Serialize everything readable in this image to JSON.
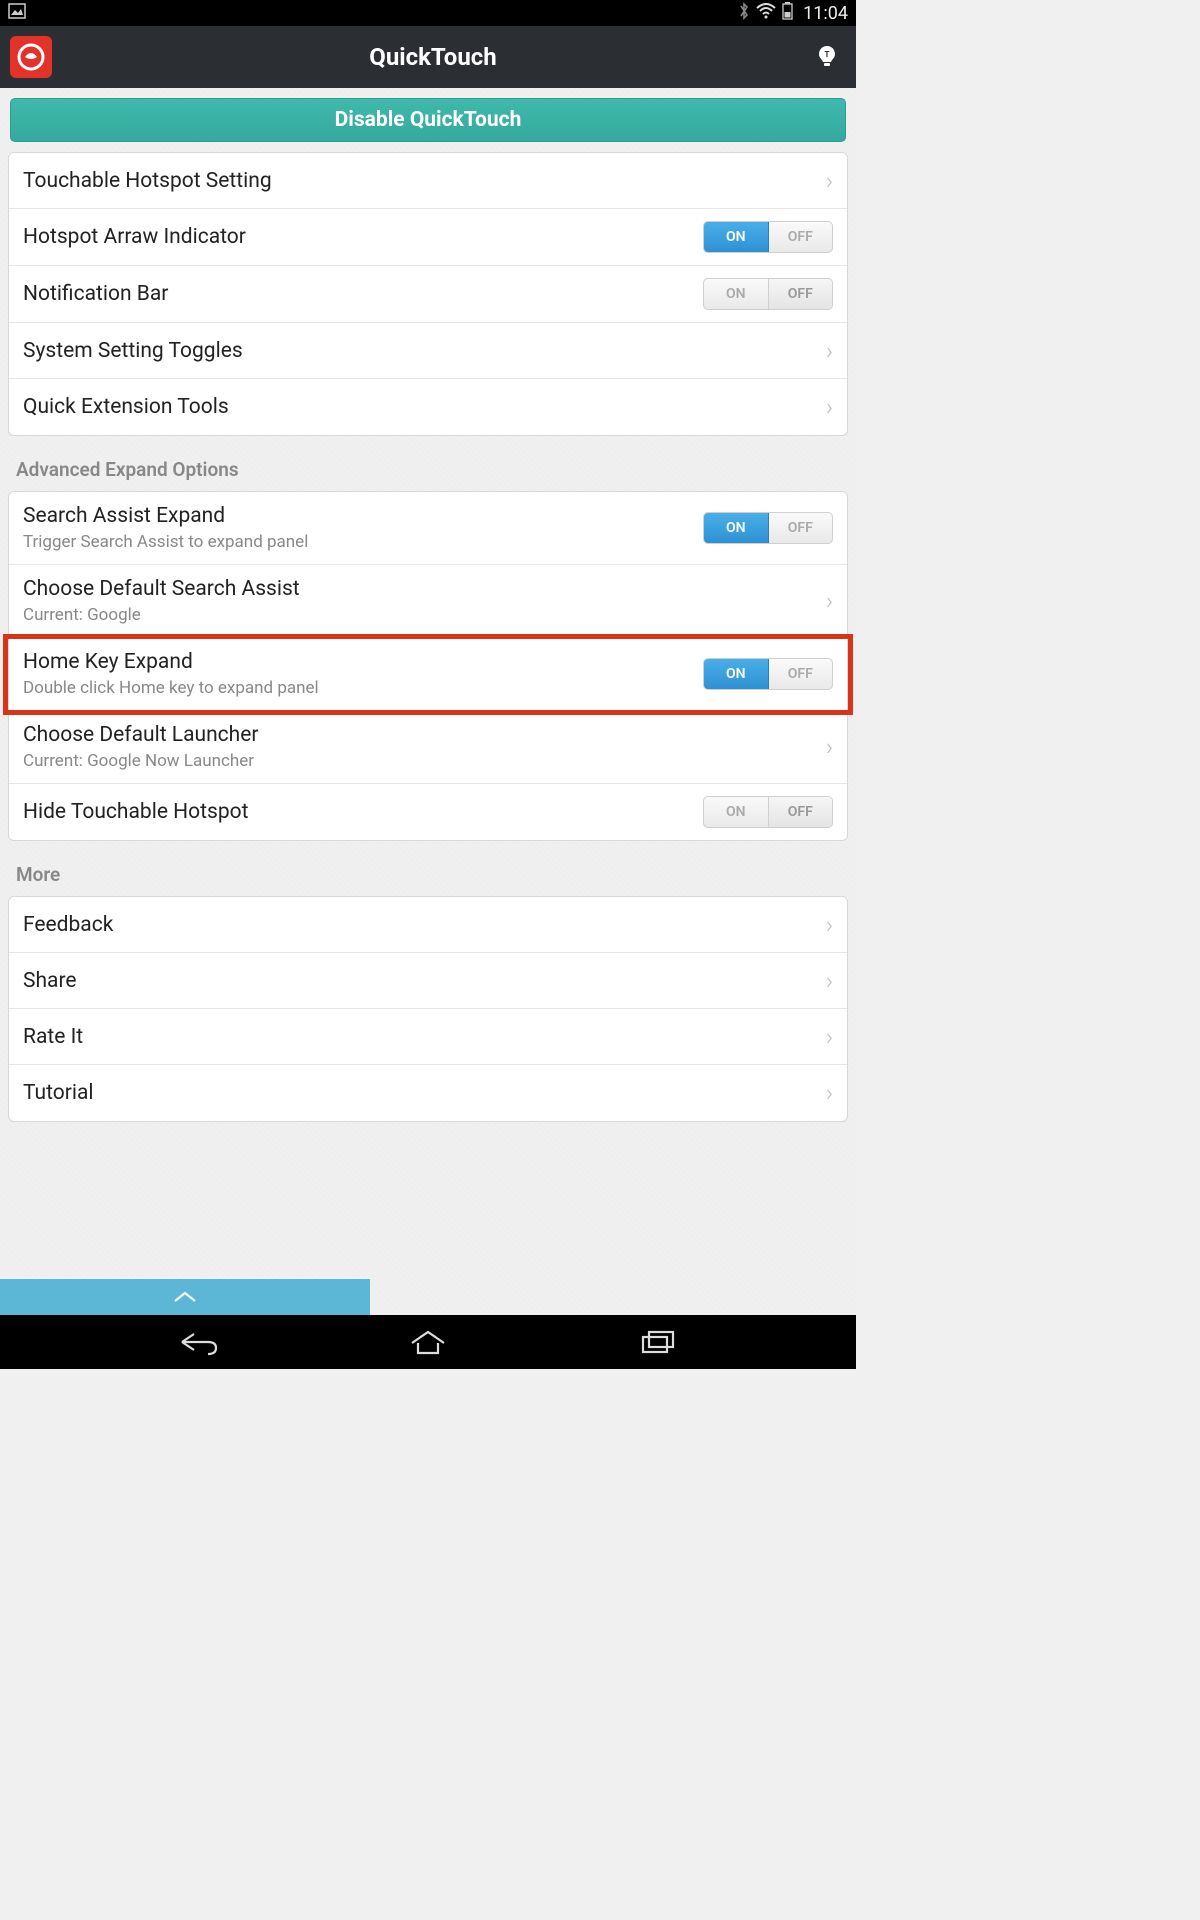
{
  "status": {
    "time": "11:04"
  },
  "header": {
    "title": "QuickTouch"
  },
  "disable_button": "Disable QuickTouch",
  "toggle_labels": {
    "on": "ON",
    "off": "OFF"
  },
  "group1": {
    "items": [
      {
        "title": "Touchable Hotspot Setting",
        "type": "nav"
      },
      {
        "title": "Hotspot Arraw Indicator",
        "type": "toggle",
        "state": "on"
      },
      {
        "title": "Notification Bar",
        "type": "toggle",
        "state": "off"
      },
      {
        "title": "System Setting Toggles",
        "type": "nav"
      },
      {
        "title": "Quick Extension Tools",
        "type": "nav"
      }
    ]
  },
  "section2_header": "Advanced Expand Options",
  "group2": {
    "items": [
      {
        "title": "Search Assist Expand",
        "sub": "Trigger Search Assist to expand panel",
        "type": "toggle",
        "state": "on"
      },
      {
        "title": "Choose Default Search Assist",
        "sub": "Current: Google",
        "type": "nav"
      },
      {
        "title": "Home Key Expand",
        "sub": "Double click Home key to expand panel",
        "type": "toggle",
        "state": "on",
        "highlighted": true
      },
      {
        "title": "Choose Default Launcher",
        "sub": "Current: Google Now Launcher",
        "type": "nav"
      },
      {
        "title": "Hide Touchable Hotspot",
        "type": "toggle",
        "state": "off"
      }
    ]
  },
  "section3_header": "More",
  "group3": {
    "items": [
      {
        "title": "Feedback",
        "type": "nav"
      },
      {
        "title": "Share",
        "type": "nav"
      },
      {
        "title": "Rate It",
        "type": "nav"
      },
      {
        "title": "Tutorial",
        "type": "nav"
      }
    ]
  }
}
